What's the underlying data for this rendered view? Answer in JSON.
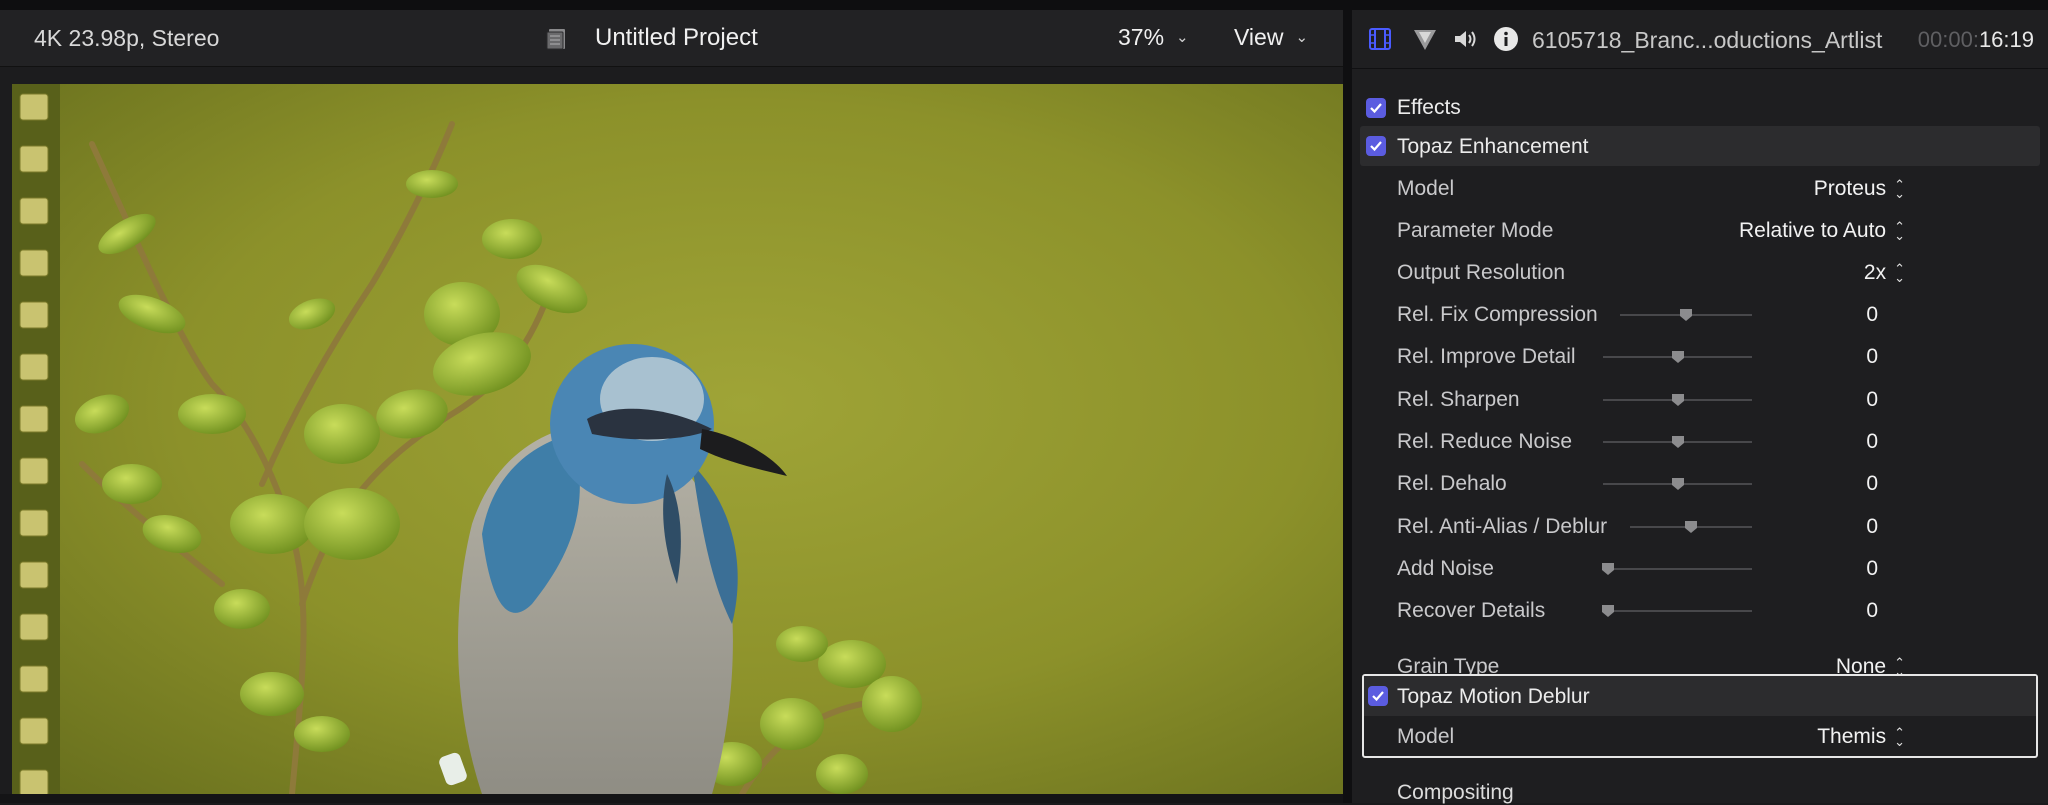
{
  "viewer": {
    "format": "4K 23.98p, Stereo",
    "project_title": "Untitled Project",
    "zoom": "37%",
    "view_label": "View"
  },
  "inspector": {
    "clip_name": "6105718_Branc...oductions_Artlist",
    "timecode_dim": "00:00:",
    "timecode": "16:19",
    "effects_label": "Effects",
    "enhancement": {
      "title": "Topaz Enhancement",
      "model_label": "Model",
      "model_value": "Proteus",
      "param_label": "Parameter Mode",
      "param_value": "Relative to Auto",
      "output_label": "Output Resolution",
      "output_value": "2x",
      "sliders": [
        {
          "label": "Rel. Fix Compression",
          "value": "0",
          "position": 0.5
        },
        {
          "label": "Rel. Improve Detail",
          "value": "0",
          "position": 0.5
        },
        {
          "label": "Rel. Sharpen",
          "value": "0",
          "position": 0.5
        },
        {
          "label": "Rel. Reduce Noise",
          "value": "0",
          "position": 0.5
        },
        {
          "label": "Rel. Dehalo",
          "value": "0",
          "position": 0.5
        },
        {
          "label": "Rel. Anti-Alias / Deblur",
          "value": "0",
          "position": 0.5
        },
        {
          "label": "Add Noise",
          "value": "0",
          "position": 0.0
        },
        {
          "label": "Recover Details",
          "value": "0",
          "position": 0.0
        }
      ],
      "grain_label": "Grain Type",
      "grain_value": "None"
    },
    "deblur": {
      "title": "Topaz Motion Deblur",
      "model_label": "Model",
      "model_value": "Themis"
    },
    "compositing_label": "Compositing"
  },
  "colors": {
    "checkbox": "#5b5ce0",
    "accent_icon": "#4a5bff"
  }
}
